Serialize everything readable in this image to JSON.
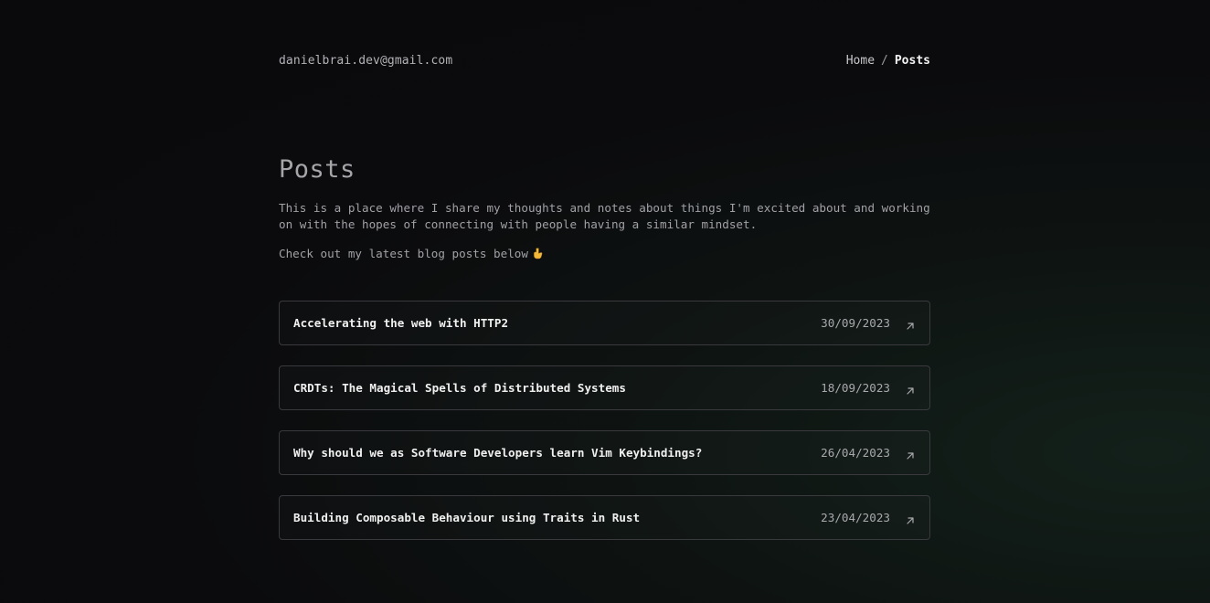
{
  "header": {
    "email": "danielbrai.dev@gmail.com",
    "breadcrumb": {
      "home": "Home",
      "separator": "/",
      "current": "Posts"
    }
  },
  "main": {
    "title": "Posts",
    "intro": "This is a place where I share my thoughts and notes about things I'm excited about and working on with the hopes of connecting with people having a similar mindset.",
    "cta": "Check out my latest blog posts below"
  },
  "posts": [
    {
      "title": "Accelerating the web with HTTP2",
      "date": "30/09/2023"
    },
    {
      "title": "CRDTs: The Magical Spells of Distributed Systems",
      "date": "18/09/2023"
    },
    {
      "title": "Why should we as Software Developers learn Vim Keybindings?",
      "date": "26/04/2023"
    },
    {
      "title": "Building Composable Behaviour using Traits in Rust",
      "date": "23/04/2023"
    }
  ],
  "icons": {
    "pointer": "pointing-down-hand-icon",
    "arrow": "arrow-up-right-icon"
  },
  "colors": {
    "background": "#0a0a0c",
    "text_primary": "#f0f0f0",
    "text_muted": "#a1a1a6",
    "border": "#3a3a3e"
  }
}
